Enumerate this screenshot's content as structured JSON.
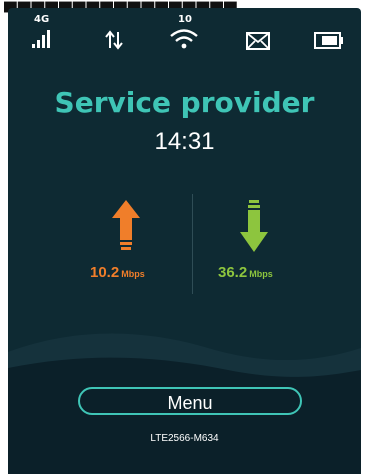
{
  "status_bar": {
    "network_type": "4G",
    "wifi_clients": "10",
    "icons": [
      "signal-icon",
      "data-transfer-icon",
      "wifi-icon",
      "mail-icon",
      "battery-icon"
    ]
  },
  "main": {
    "provider": "Service provider",
    "time": "14:31"
  },
  "speeds": {
    "upload_value": "10.2",
    "upload_unit": "Mbps",
    "download_value": "36.2",
    "download_unit": "Mbps"
  },
  "footer": {
    "menu_label": "Menu",
    "model": "LTE2566-M634"
  },
  "colors": {
    "background": "#0e2a33",
    "accent": "#3fc5b6",
    "upload": "#f07e2a",
    "download": "#8dc53e"
  }
}
